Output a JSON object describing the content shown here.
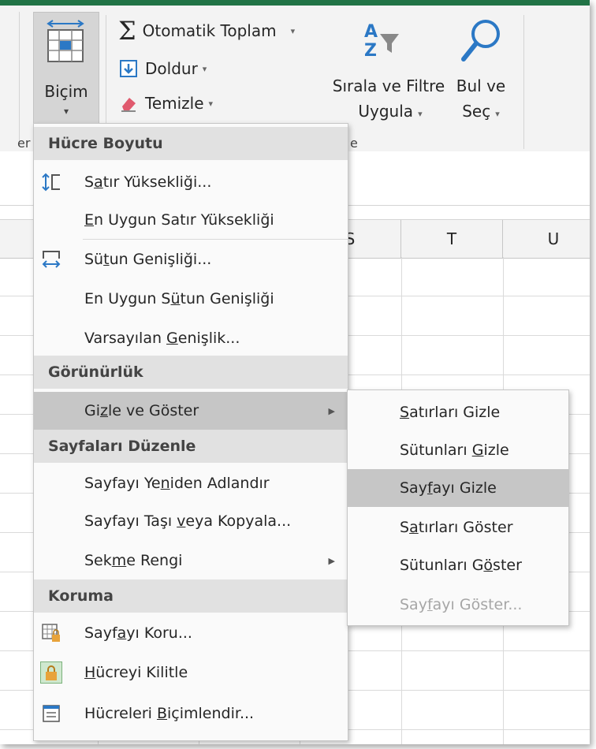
{
  "ribbon": {
    "bicim_label": "Biçim",
    "autosum_label": "Otomatik Toplam",
    "fill_label": "Doldur",
    "clear_label": "Temizle",
    "sort_filter_line1": "Sırala ve Filtre",
    "sort_filter_line2": "Uygula",
    "find_select_line1": "Bul ve",
    "find_select_line2": "Seç",
    "left_group_caption": "er",
    "edit_group_caption": "e",
    "sort_icon_letters": "AZ"
  },
  "columns": [
    "S",
    "T",
    "U"
  ],
  "menu": {
    "headers": {
      "cell_size": "Hücre Boyutu",
      "visibility": "Görünürlük",
      "organize_sheets": "Sayfaları Düzenle",
      "protection": "Koruma"
    },
    "items": {
      "row_height_pre": "S",
      "row_height_u": "a",
      "row_height_post": "tır Yüksekliği...",
      "autofit_row_u": "E",
      "autofit_row_post": "n Uygun Satır Yüksekliği",
      "col_width_pre": "Sü",
      "col_width_u": "t",
      "col_width_post": "un Genişliği...",
      "autofit_col_pre": "En Uygun S",
      "autofit_col_u": "ü",
      "autofit_col_post": "tun Genişliği",
      "default_width_pre": "Varsayılan ",
      "default_width_u": "G",
      "default_width_post": "enişlik...",
      "hide_show_pre": "Gi",
      "hide_show_u": "z",
      "hide_show_post": "le ve Göster",
      "rename_pre": "Sayfayı Ye",
      "rename_u": "n",
      "rename_post": "iden Adlandır",
      "move_copy_pre": "Sayfayı Taşı ",
      "move_copy_u": "v",
      "move_copy_post": "eya Kopyala...",
      "tab_color_pre": "Sek",
      "tab_color_u": "m",
      "tab_color_post": "e Rengi",
      "protect_pre": "Sayf",
      "protect_u": "a",
      "protect_post": "yı Koru...",
      "lock_u": "H",
      "lock_post": "ücreyi Kilitle",
      "format_cells_pre": "Hücreleri ",
      "format_cells_u": "B",
      "format_cells_post": "içimlendir..."
    }
  },
  "submenu": {
    "hide_rows_u": "S",
    "hide_rows_post": "atırları Gizle",
    "hide_cols_pre": "Sütunları ",
    "hide_cols_u": "G",
    "hide_cols_post": "izle",
    "hide_sheet_pre": "Say",
    "hide_sheet_u": "f",
    "hide_sheet_post": "ayı Gizle",
    "show_rows_pre": "S",
    "show_rows_u": "a",
    "show_rows_post": "tırları Göster",
    "show_cols_pre": "Sütunları G",
    "show_cols_u": "ö",
    "show_cols_post": "ster",
    "show_sheet_pre": "Say",
    "show_sheet_u": "f",
    "show_sheet_post": "ayı Göster..."
  },
  "colors": {
    "accent_green": "#217346",
    "highlight": "#c6c6c6",
    "header_bg": "#e1e1e1",
    "find_icon": "#2b78c5",
    "sort_icon": "#2b78c5",
    "lock_icon": "#e8a33b"
  }
}
